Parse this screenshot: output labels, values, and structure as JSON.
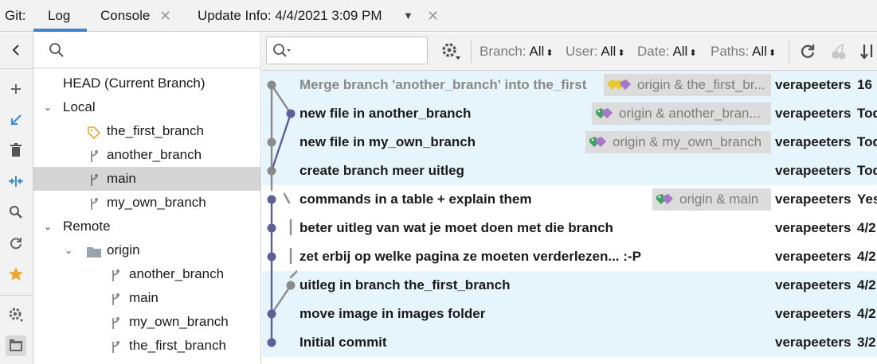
{
  "tabbar": {
    "git_label": "Git:",
    "tabs": [
      {
        "label": "Log",
        "active": true
      },
      {
        "label": "Console",
        "closable": true
      },
      {
        "label": "Update Info: 4/4/2021 3:09 PM",
        "closable": true,
        "dropdown": true
      }
    ]
  },
  "toolstrip": {
    "icons": [
      "back-arrow-icon",
      "add-icon",
      "fetch-icon",
      "delete-icon",
      "merge-icon",
      "search-icon",
      "refresh-icon",
      "favorite-star-icon",
      "settings-icon",
      "panel-toggle-icon"
    ]
  },
  "tree": {
    "head_label": "HEAD (Current Branch)",
    "local_label": "Local",
    "local_branches": [
      "the_first_branch",
      "another_branch",
      "main",
      "my_own_branch"
    ],
    "selected_branch": "main",
    "remote_label": "Remote",
    "remote_name": "origin",
    "remote_branches": [
      "another_branch",
      "main",
      "my_own_branch",
      "the_first_branch"
    ]
  },
  "toolbar": {
    "search_placeholder": "",
    "filters": {
      "branch_label": "Branch:",
      "branch_value": "All",
      "user_label": "User:",
      "user_value": "All",
      "date_label": "Date:",
      "date_value": "All",
      "paths_label": "Paths:",
      "paths_value": "All"
    }
  },
  "commits": [
    {
      "message": "Merge branch 'another_branch' into the_first",
      "refs": "origin & the_first_br...",
      "author": "verapeeters",
      "date": "16",
      "dim": true,
      "highlight": true,
      "tag_colors": [
        "#e8c930",
        "#a678c8"
      ]
    },
    {
      "message": "new file in another_branch",
      "refs": "origin & another_bran...",
      "author": "verapeeters",
      "date": "Tod",
      "highlight": true,
      "tag_colors": [
        "#3aa55d",
        "#a678c8"
      ]
    },
    {
      "message": "new file in my_own_branch",
      "refs": "origin & my_own_branch",
      "author": "verapeeters",
      "date": "Tod",
      "highlight": true,
      "tag_colors": [
        "#3aa55d",
        "#a678c8"
      ]
    },
    {
      "message": "create branch meer uitleg",
      "refs": "",
      "author": "verapeeters",
      "date": "Tod",
      "highlight": true
    },
    {
      "message": "commands in a table + explain them",
      "refs": "origin & main",
      "author": "verapeeters",
      "date": "Yes",
      "highlight": false,
      "tag_colors": [
        "#3aa55d",
        "#a678c8"
      ]
    },
    {
      "message": "beter uitleg van wat je moet doen met die branch",
      "refs": "",
      "author": "verapeeters",
      "date": "4/2",
      "highlight": false
    },
    {
      "message": "zet erbij op welke pagina ze moeten verderlezen... :-P",
      "refs": "",
      "author": "verapeeters",
      "date": "4/2",
      "highlight": false
    },
    {
      "message": "uitleg in branch the_first_branch",
      "refs": "",
      "author": "verapeeters",
      "date": "4/2",
      "highlight": true
    },
    {
      "message": "move image in images folder",
      "refs": "",
      "author": "verapeeters",
      "date": "4/2",
      "highlight": true
    },
    {
      "message": "Initial commit",
      "refs": "",
      "author": "verapeeters",
      "date": "3/2",
      "highlight": true
    }
  ],
  "colors": {
    "accent": "#4083c9",
    "graph_gray": "#8a8a8a",
    "graph_purple": "#5d5f96",
    "row_highlight": "#e5f5fb",
    "selection": "#d5d5d5"
  }
}
